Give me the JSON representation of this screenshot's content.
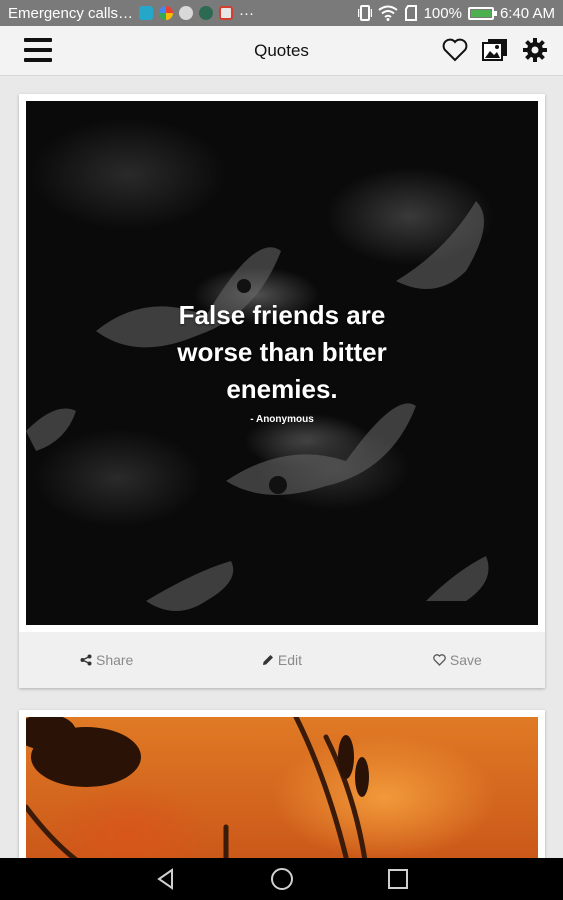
{
  "status_bar": {
    "left_text": "Emergency calls…",
    "ellipsis": "···",
    "battery": "100%",
    "time": "6:40 AM",
    "battery_level": 1.0
  },
  "app_bar": {
    "title": "Quotes",
    "icons": [
      "menu-icon",
      "heart-icon",
      "gallery-icon",
      "gear-icon"
    ]
  },
  "cards": [
    {
      "quote": "False friends are worse than bitter enemies.",
      "author": "- Anonymous",
      "actions": {
        "share": "Share",
        "edit": "Edit",
        "save": "Save"
      }
    }
  ],
  "nav_bar": {
    "icons": [
      "back-icon",
      "home-icon",
      "recents-icon"
    ]
  },
  "colors": {
    "status_bar": "#7a7a7a",
    "app_bar": "#f3f3f3",
    "nav_bar": "#000000",
    "action_text": "#8a8a8a",
    "battery_fill": "#4caf50"
  }
}
